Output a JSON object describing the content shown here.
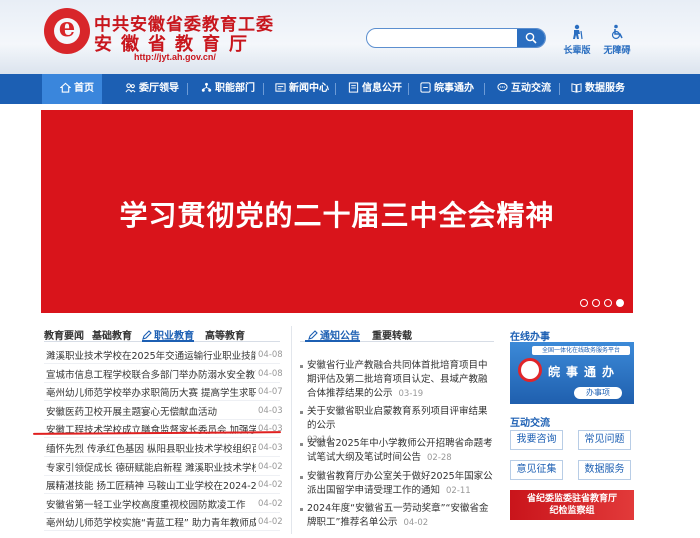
{
  "header": {
    "title_line1": "中共安徽省委教育工委",
    "title_line2": "安徽省教育厅",
    "url": "http://jyt.ah.gov.cn/",
    "search_placeholder": "",
    "elder_label": "长辈版",
    "access_label": "无障碍"
  },
  "nav": {
    "items": [
      {
        "label": "首页",
        "icon": "home-icon"
      },
      {
        "label": "委厅领导",
        "icon": "leaders-icon"
      },
      {
        "label": "职能部门",
        "icon": "departments-icon"
      },
      {
        "label": "新闻中心",
        "icon": "news-icon"
      },
      {
        "label": "信息公开",
        "icon": "disclosure-icon"
      },
      {
        "label": "皖事通办",
        "icon": "service-icon"
      },
      {
        "label": "互动交流",
        "icon": "interaction-icon"
      },
      {
        "label": "数据服务",
        "icon": "data-icon"
      }
    ]
  },
  "banner": {
    "text": "学习贯彻党的二十届三中全会精神",
    "bg_color": "#d9141b",
    "slide_count": 4,
    "active_slide": 4
  },
  "left": {
    "tabs": [
      "教育要闻",
      "基础教育",
      "职业教育",
      "高等教育"
    ],
    "active_tab": 2,
    "items": [
      {
        "text": "濉溪职业技术学校在2025年交通运输行业职业技能...",
        "date": "04-08"
      },
      {
        "text": "宣城市信息工程学校联合多部门举办防溺水安全教育...",
        "date": "04-08"
      },
      {
        "text": "亳州幼儿师范学校举办求职简历大赛 提高学生求职技...",
        "date": "04-07"
      },
      {
        "text": "安徽医药卫校开展主题宴心无偿献血活动",
        "date": "04-03"
      },
      {
        "text": "安徽工程技术学校成立膳食监督家长委员会 加强学校...",
        "date": "04-03"
      },
      {
        "text": "缅怀先烈 传承红色基因 枞阳县职业技术学校组织百...",
        "date": "04-03"
      },
      {
        "text": "专家引领促成长 德研赋能启新程 濉溪职业技术学校...",
        "date": "04-02"
      },
      {
        "text": "展精湛技能 扬工匠精神 马鞍山工业学校在2024-202...",
        "date": "04-02"
      },
      {
        "text": "安徽省第一轻工业学校高度重视校园防欺凌工作",
        "date": "04-02"
      },
      {
        "text": "亳州幼儿师范学校实施“青蓝工程” 助力青年教师成...",
        "date": "04-02"
      }
    ]
  },
  "middle": {
    "tabs": [
      "通知公告",
      "重要转载"
    ],
    "active_tab": 0,
    "items": [
      {
        "text": "安徽省行业产教融合共同体首批培育项目中期评估及第二批培育项目认定、县域产教融合体推荐结果的公示",
        "date": "03-19"
      },
      {
        "text": "关于安徽省职业启蒙教育系列项目评审结果的公示",
        "date": "03-14"
      },
      {
        "text": "安徽省2025年中小学教师公开招聘省命题考试笔试大纲及笔试时间公告",
        "date": "02-28"
      },
      {
        "text": "安徽省教育厅办公室关于做好2025年国家公派出国留学申请受理工作的通知",
        "date": "02-11"
      },
      {
        "text": "2024年度“安徽省五一劳动奖章”“安徽省金牌职工”推荐名单公示",
        "date": "04-02"
      }
    ]
  },
  "right": {
    "online_title": "在线办事",
    "wan_top": "全国一体化在线政务服务平台",
    "wan_big": "皖事通办",
    "wan_btn": "办事项",
    "interact_title": "互动交流",
    "buttons": [
      "我要咨询",
      "常见问题",
      "意见征集",
      "数据服务"
    ],
    "discipline_line1": "省纪委监委驻省教育厅",
    "discipline_line2": "纪检监察组"
  },
  "colors": {
    "brand_red": "#c8161d",
    "nav_blue": "#1c5fb3",
    "nav_active": "#3a86dc"
  }
}
